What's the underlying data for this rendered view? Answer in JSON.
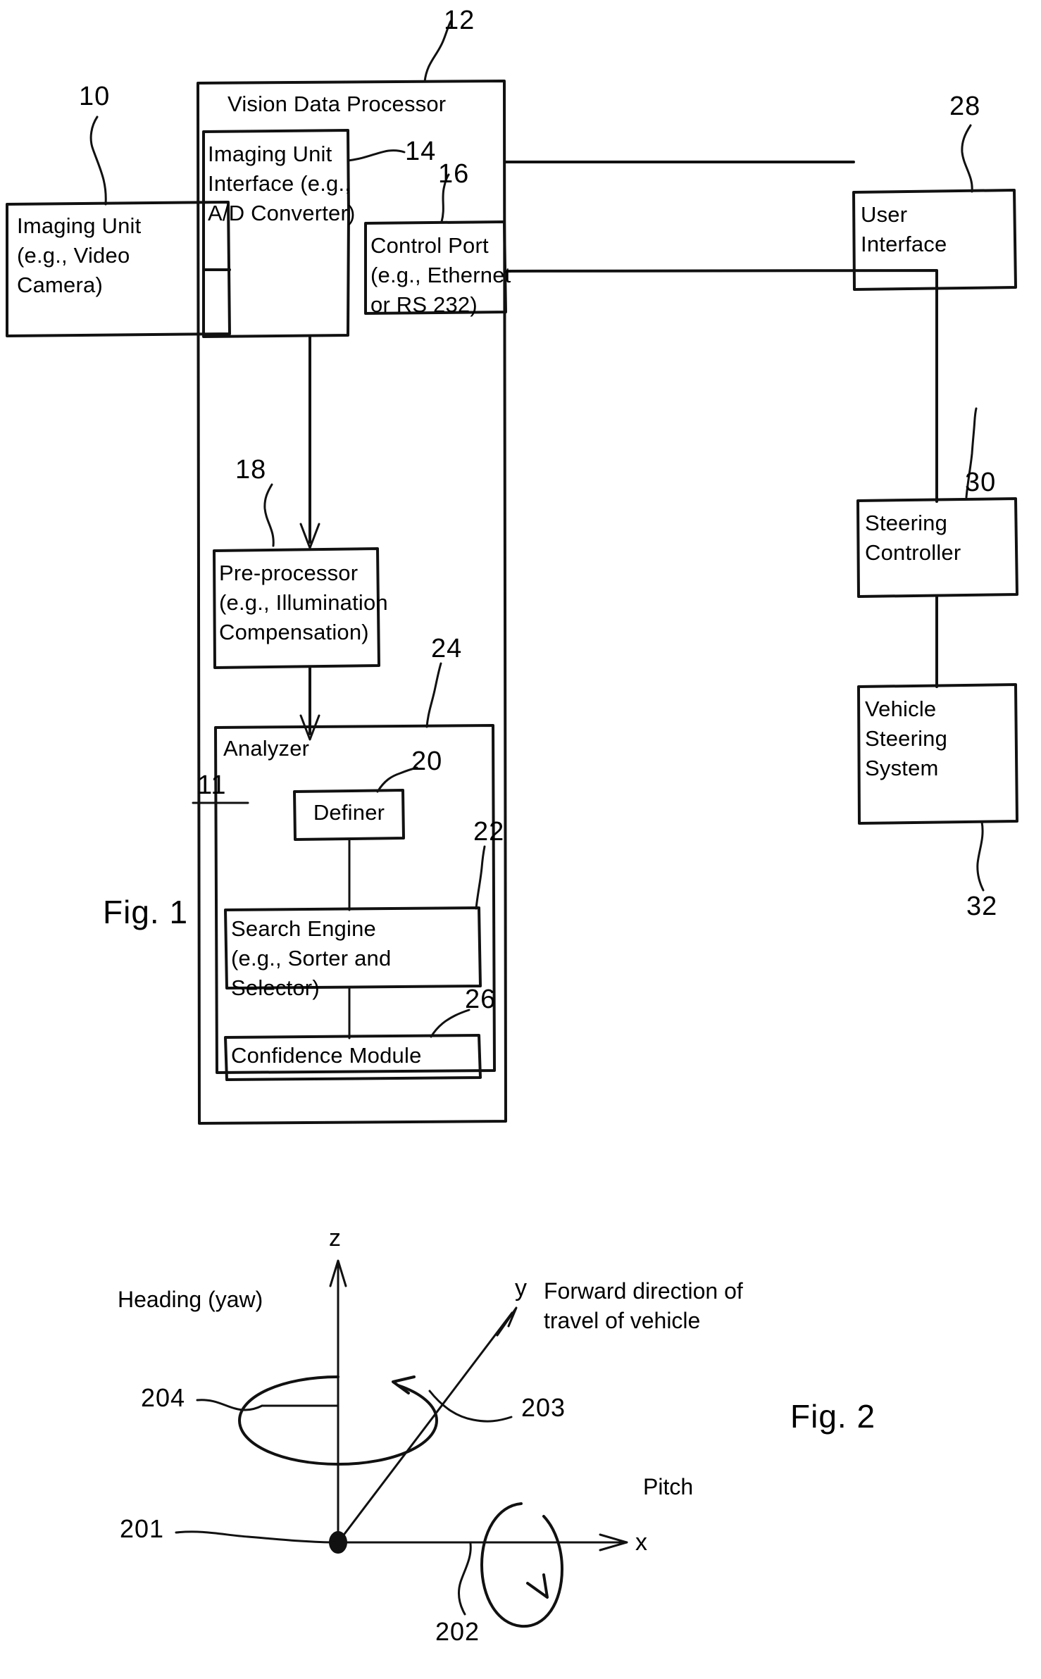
{
  "figure1": {
    "caption": "Fig. 1",
    "system_ref": "11",
    "boxes": {
      "imaging_unit": {
        "lines": "Imaging Unit\n(e.g., Video\nCamera)",
        "ref": "10"
      },
      "vision_data_processor": {
        "title": "Vision Data Processor",
        "ref": "12"
      },
      "imaging_unit_interface": {
        "lines": "Imaging Unit\nInterface (e.g.,\nA/D Converter)",
        "ref": "14"
      },
      "control_port": {
        "lines": "Control Port\n(e.g., Ethernet\nor RS 232)",
        "ref": "16"
      },
      "pre_processor": {
        "lines": "Pre-processor\n(e.g., Illumination\nCompensation)",
        "ref": "18"
      },
      "analyzer": {
        "title": "Analyzer",
        "ref": "24"
      },
      "definer": {
        "label": "Definer",
        "ref": "20"
      },
      "search_engine": {
        "lines": "Search Engine\n(e.g., Sorter and Selector)",
        "ref": "22"
      },
      "confidence_module": {
        "label": "Confidence Module",
        "ref": "26"
      },
      "user_interface": {
        "lines": "User\nInterface",
        "ref": "28"
      },
      "steering_controller": {
        "lines": "Steering\nController",
        "ref": "30"
      },
      "vehicle_steering_system": {
        "lines": "Vehicle\nSteering\nSystem",
        "ref": "32"
      }
    }
  },
  "figure2": {
    "caption": "Fig. 2",
    "axis_z_label": "z",
    "axis_y_label": "y",
    "axis_x_label": "x",
    "heading_label": "Heading (yaw)",
    "pitch_label": "Pitch",
    "forward_label": "Forward direction of\ntravel of vehicle",
    "ref_origin": "201",
    "ref_roll_axis": "202",
    "ref_forward_axis": "203",
    "ref_yaw_axis": "204"
  },
  "style": {
    "ink": "#111111",
    "paper": "#ffffff"
  }
}
